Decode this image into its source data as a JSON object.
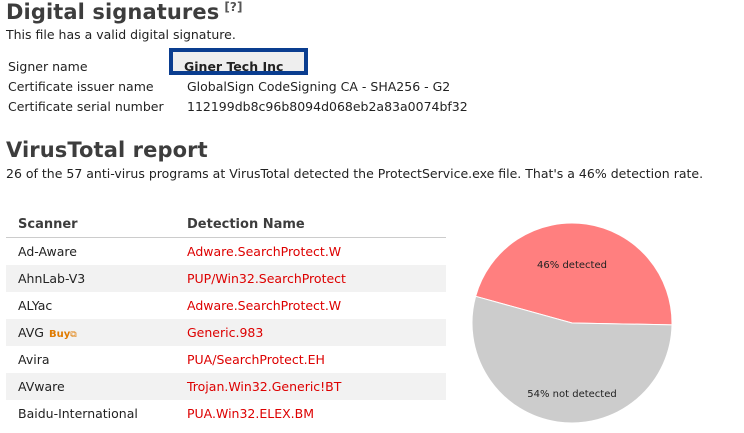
{
  "digital_signatures": {
    "title": "Digital signatures",
    "help_link": "[?]",
    "status": "This file has a valid digital signature.",
    "fields": [
      {
        "label": "Signer name",
        "value": "Giner Tech Inc"
      },
      {
        "label": "Certificate issuer name",
        "value": "GlobalSign CodeSigning CA - SHA256 - G2"
      },
      {
        "label": "Certificate serial number",
        "value": "112199db8c96b8094d068eb2a83a0074bf32"
      }
    ]
  },
  "virustotal": {
    "title": "VirusTotal report",
    "summary": "26 of the 57 anti-virus programs at VirusTotal detected the ProtectService.exe file. That's a 46% detection rate.",
    "table": {
      "headers": [
        "Scanner",
        "Detection Name"
      ],
      "rows": [
        {
          "scanner": "Ad-Aware",
          "detection": "Adware.SearchProtect.W"
        },
        {
          "scanner": "AhnLab-V3",
          "detection": "PUP/Win32.SearchProtect"
        },
        {
          "scanner": "ALYac",
          "detection": "Adware.SearchProtect.W"
        },
        {
          "scanner": "AVG",
          "buy": "Buy",
          "detection": "Generic.983"
        },
        {
          "scanner": "Avira",
          "detection": "PUA/SearchProtect.EH"
        },
        {
          "scanner": "AVware",
          "detection": "Trojan.Win32.Generic!BT"
        },
        {
          "scanner": "Baidu-International",
          "detection": "PUA.Win32.ELEX.BM"
        }
      ]
    }
  },
  "chart_data": {
    "type": "pie",
    "categories": [
      "detected",
      "not detected"
    ],
    "values": [
      46,
      54
    ],
    "labels": [
      "46% detected",
      "54% not detected"
    ],
    "colors": [
      "#ff7f7f",
      "#cccccc"
    ]
  }
}
